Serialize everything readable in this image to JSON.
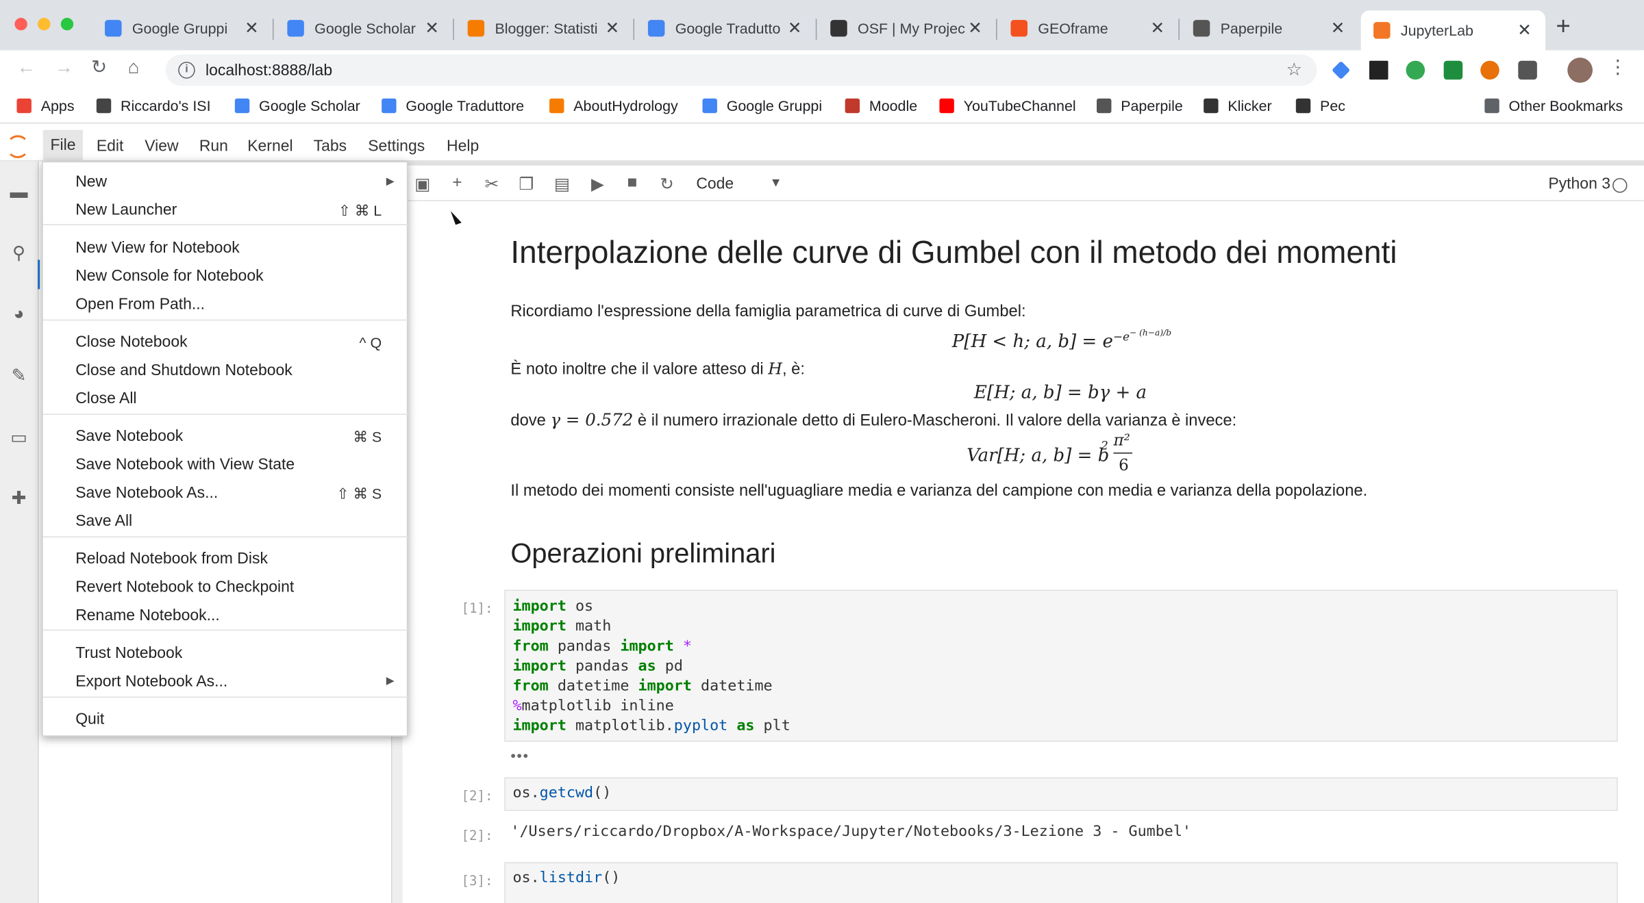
{
  "browser": {
    "tabs": [
      {
        "title": "Google Gruppi",
        "icon": "google-groups-icon",
        "color": "#4285f4"
      },
      {
        "title": "Google Scholar",
        "icon": "google-scholar-icon",
        "color": "#4285f4"
      },
      {
        "title": "Blogger: Statisti",
        "icon": "blogger-icon",
        "color": "#f57c00"
      },
      {
        "title": "Google Tradutto",
        "icon": "google-translate-icon",
        "color": "#4285f4"
      },
      {
        "title": "OSF | My Projec",
        "icon": "osf-icon",
        "color": "#333333"
      },
      {
        "title": "GEOframe",
        "icon": "blogger-icon",
        "color": "#f4511e"
      },
      {
        "title": "Paperpile",
        "icon": "paperpile-icon",
        "color": "#555555"
      },
      {
        "title": "JupyterLab",
        "icon": "jupyter-icon",
        "color": "#f37626"
      }
    ],
    "close_glyph": "✕",
    "new_tab": "+",
    "url": "localhost:8888/lab",
    "info_glyph": "i",
    "star_glyph": "☆",
    "bookmarks": [
      {
        "label": "Apps",
        "icon": "apps-grid-icon",
        "color": "#ea4335"
      },
      {
        "label": "Riccardo's ISI",
        "icon": "paperpile-icon",
        "color": "#444444"
      },
      {
        "label": "Google Scholar",
        "icon": "google-scholar-icon",
        "color": "#4285f4"
      },
      {
        "label": "Google Traduttore",
        "icon": "google-translate-icon",
        "color": "#4285f4"
      },
      {
        "label": "AboutHydrology",
        "icon": "blogger-icon",
        "color": "#f57c00"
      },
      {
        "label": "Google Gruppi",
        "icon": "google-groups-icon",
        "color": "#4285f4"
      },
      {
        "label": "Moodle",
        "icon": "moodle-icon",
        "color": "#c0392b"
      },
      {
        "label": "YouTubeChannel",
        "icon": "youtube-icon",
        "color": "#ff0000"
      },
      {
        "label": "Paperpile",
        "icon": "paperpile-icon",
        "color": "#555555"
      },
      {
        "label": "Klicker",
        "icon": "klicker-icon",
        "color": "#333333"
      },
      {
        "label": "Pec",
        "icon": "pec-icon",
        "color": "#333333"
      },
      {
        "label": "Other Bookmarks",
        "icon": "folder-icon",
        "color": "#5f6368"
      }
    ]
  },
  "jupyter": {
    "menu": [
      "File",
      "Edit",
      "View",
      "Run",
      "Kernel",
      "Tabs",
      "Settings",
      "Help"
    ],
    "cell_type": "Code",
    "kernel": "Python 3"
  },
  "file_menu": {
    "items": [
      {
        "label": "New",
        "shortcut": "",
        "submenu": true
      },
      {
        "label": "New Launcher",
        "shortcut": "⇧ ⌘ L"
      },
      {
        "label": "New View for Notebook",
        "shortcut": ""
      },
      {
        "label": "New Console for Notebook",
        "shortcut": ""
      },
      {
        "label": "Open From Path...",
        "shortcut": ""
      },
      {
        "label": "Close Notebook",
        "shortcut": "^ Q"
      },
      {
        "label": "Close and Shutdown Notebook",
        "shortcut": ""
      },
      {
        "label": "Close All",
        "shortcut": ""
      },
      {
        "label": "Save Notebook",
        "shortcut": "⌘ S"
      },
      {
        "label": "Save Notebook with View State",
        "shortcut": ""
      },
      {
        "label": "Save Notebook As...",
        "shortcut": "⇧ ⌘ S"
      },
      {
        "label": "Save All",
        "shortcut": ""
      },
      {
        "label": "Reload Notebook from Disk",
        "shortcut": ""
      },
      {
        "label": "Revert Notebook to Checkpoint",
        "shortcut": ""
      },
      {
        "label": "Rename Notebook...",
        "shortcut": ""
      },
      {
        "label": "Trust Notebook",
        "shortcut": ""
      },
      {
        "label": "Export Notebook As...",
        "shortcut": "",
        "submenu": true
      },
      {
        "label": "Quit",
        "shortcut": ""
      }
    ]
  },
  "notebook": {
    "title": "Interpolazione delle curve di Gumbel con il metodo dei momenti",
    "p1": "Ricordiamo l'espressione della famiglia parametrica di curve di Gumbel:",
    "eq1": "P[H < h; a, b] = e",
    "eq1_sup": "−e",
    "eq1_supsup": "− (h−a)/b",
    "p2a": "È noto inoltre che il valore atteso di",
    "p2_var": "H",
    "p2b": ", è:",
    "eq2": "E[H; a, b] = bγ + a",
    "p3a": "dove",
    "p3_math": "γ = 0.572",
    "p3b": "è il numero irrazionale detto di Eulero-Mascheroni. Il valore della varianza è invece:",
    "eq3_lhs": "Var[H; a, b] = b",
    "eq3_sq": "2",
    "eq3_num": "π²",
    "eq3_den": "6",
    "p4": "Il metodo dei momenti consiste nell'uguagliare media e varianza del campione con media e varianza della popolazione.",
    "h2": "Operazioni preliminari",
    "prompts": [
      "[1]:",
      "[2]:",
      "[2]:",
      "[3]:"
    ],
    "ellipsis": "•••",
    "out2": "'/Users/riccardo/Dropbox/A-Workspace/Jupyter/Notebooks/3-Lezione 3 - Gumbel'"
  }
}
